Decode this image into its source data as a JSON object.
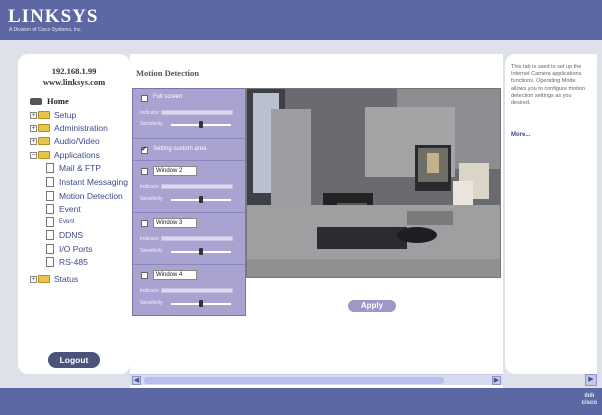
{
  "header": {
    "logo": "LINKSYS",
    "logo_sub": "A Division of Cisco Systems, Inc."
  },
  "sidebar": {
    "ip": "192.168.1.99",
    "site": "www.linksys.com",
    "items": [
      {
        "label": "Home"
      },
      {
        "label": "Setup"
      },
      {
        "label": "Administration"
      },
      {
        "label": "Audio/Video"
      },
      {
        "label": "Applications"
      },
      {
        "label": "Mail & FTP"
      },
      {
        "label": "Instant Messaging"
      },
      {
        "label": "Motion Detection"
      },
      {
        "label": "Event"
      },
      {
        "label": "Event"
      },
      {
        "label": "DDNS"
      },
      {
        "label": "I/O Ports"
      },
      {
        "label": "RS-485"
      },
      {
        "label": "Status"
      }
    ],
    "logout": "Logout"
  },
  "main": {
    "title": "Motion Detection",
    "full_screen": "Full screen",
    "custom_area": "Setting custom area",
    "indicator_label": "Indicator",
    "sensitivity_label": "Sensitivity",
    "windows": [
      {
        "name": "Window 2"
      },
      {
        "name": "Window 3"
      },
      {
        "name": "Window 4"
      }
    ],
    "apply": "Apply"
  },
  "help": {
    "text": "This tab is used to set up the Internet Camera applications functions. Operating Mode allows you to configure motion detection settings as you desired.",
    "more": "More..."
  },
  "footer": {
    "brand": "cisco"
  },
  "colors": {
    "header": "#5c67a3",
    "panel": "#a8a3d1",
    "page_bg": "#dfe1ea"
  }
}
